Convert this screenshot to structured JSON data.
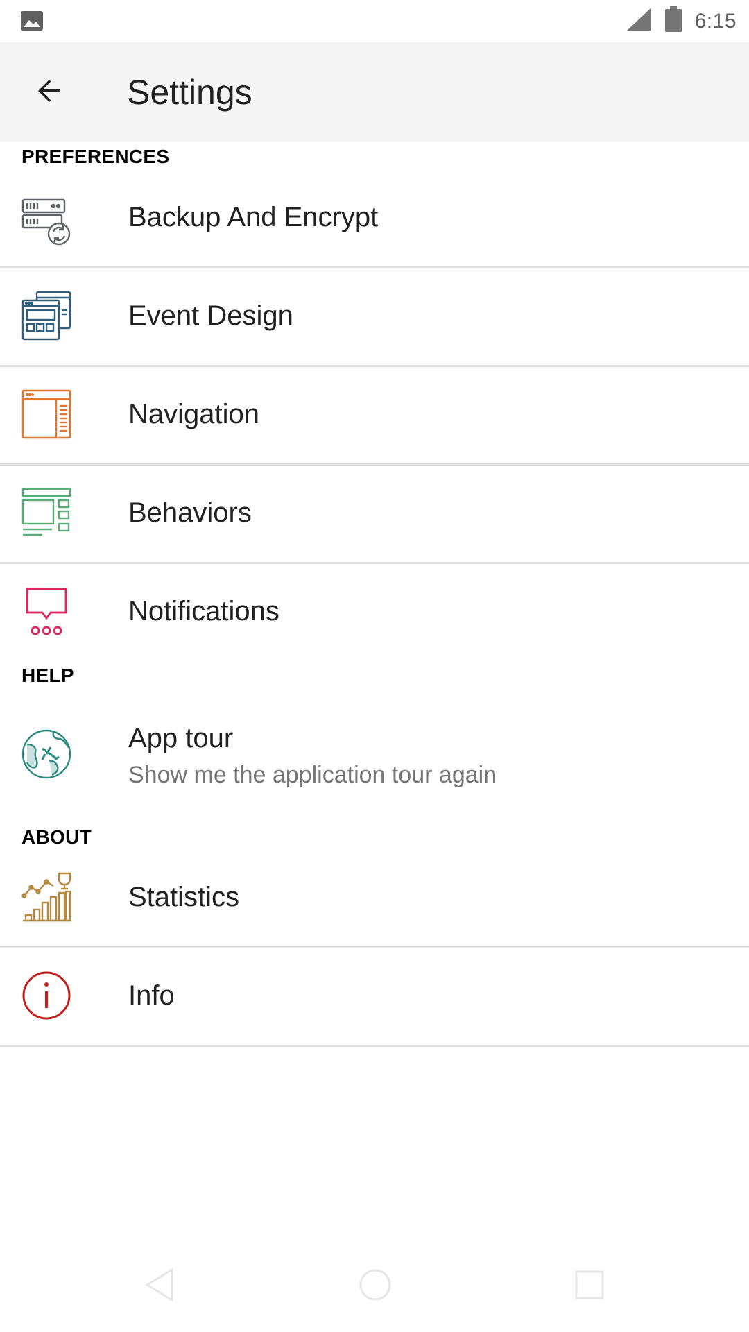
{
  "status_bar": {
    "time": "6:15",
    "left_icon": "image-icon",
    "signal_icon": "signal-icon",
    "battery_icon": "battery-icon"
  },
  "app_bar": {
    "back_icon": "arrow-back-icon",
    "title": "Settings"
  },
  "sections": {
    "preferences": "PREFERENCES",
    "help": "HELP",
    "about": "ABOUT"
  },
  "items": {
    "backup": {
      "label": "Backup And Encrypt",
      "icon": "server-sync-icon",
      "color": "#5f6368"
    },
    "event_design": {
      "label": "Event Design",
      "icon": "browser-windows-icon",
      "color": "#2f5d7c"
    },
    "navigation": {
      "label": "Navigation",
      "icon": "sidebar-layout-icon",
      "color": "#e2762a"
    },
    "behaviors": {
      "label": "Behaviors",
      "icon": "layout-blocks-icon",
      "color": "#5aaa7a"
    },
    "notifications": {
      "label": "Notifications",
      "icon": "chat-bubble-icon",
      "color": "#e0245e"
    },
    "app_tour": {
      "label": "App tour",
      "sublabel": "Show me the application tour again",
      "icon": "globe-plane-icon",
      "color": "#2a8a7f"
    },
    "statistics": {
      "label": "Statistics",
      "icon": "stats-trophy-icon",
      "color": "#b58a3c"
    },
    "info": {
      "label": "Info",
      "icon": "info-icon",
      "color": "#c81e1e"
    }
  },
  "nav_bar": {
    "back": "nav-back-icon",
    "home": "nav-home-icon",
    "recents": "nav-recents-icon"
  }
}
